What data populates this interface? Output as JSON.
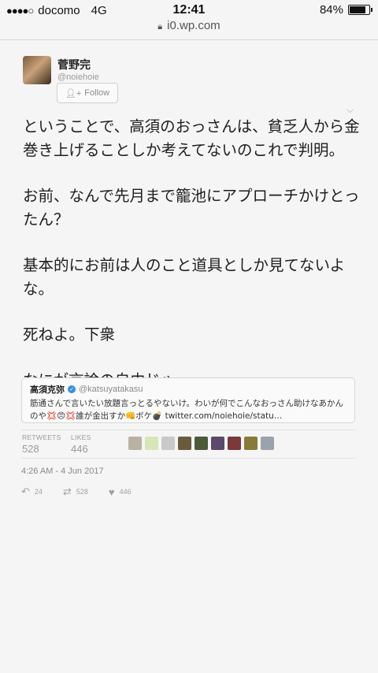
{
  "status_bar": {
    "carrier": "docomo",
    "network": "4G",
    "time": "12:41",
    "battery": "84%"
  },
  "url_bar": {
    "url": "i0.wp.com"
  },
  "tweet": {
    "author_name": "菅野完",
    "author_handle": "@noiehoie",
    "follow_label": "Follow",
    "paragraphs": [
      "ということで、高須のおっさんは、貧乏人から金巻き上げることしか考えてないのこれで判明。",
      "お前、なんで先月まで籠池にアプローチかけとったん？",
      "基本的にお前は人のこと道具としか見てないよな。",
      "死ねよ。下衆",
      "なにが言論の自由じゃ。"
    ],
    "quote": {
      "name": "高須克弥",
      "handle": "@katsuyatakasu",
      "text_line1": "筋通さんで言いたい放題言っとるやないけ。わいが何でこんなおっさん助けなあかん",
      "text_line2": "のや💢😠💢誰が金出すか👊ボケ💣 twitter.com/noiehoie/statu…"
    },
    "retweets_label": "RETWEETS",
    "retweets_count": "528",
    "likes_label": "LIKES",
    "likes_count": "446",
    "timestamp": "4:26 AM - 4 Jun 2017",
    "reply_count": "24",
    "retweet_action_count": "528",
    "like_action_count": "446"
  },
  "colors": {
    "background": "#f5f5f5",
    "text": "#1e1e1e",
    "muted": "#9a9a9a",
    "verified": "#3a8fe0"
  }
}
